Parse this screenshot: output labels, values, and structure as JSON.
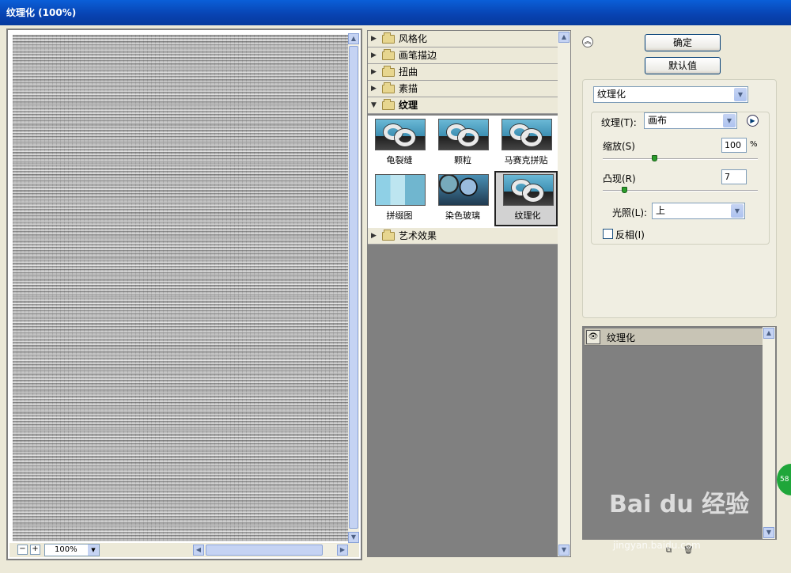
{
  "window": {
    "title": "纹理化 (100%)"
  },
  "preview": {
    "zoom_minus": "−",
    "zoom_plus": "+",
    "zoom_value": "100%"
  },
  "gallery": {
    "categories": [
      {
        "label": "风格化",
        "open": false
      },
      {
        "label": "画笔描边",
        "open": false
      },
      {
        "label": "扭曲",
        "open": false
      },
      {
        "label": "素描",
        "open": false
      },
      {
        "label": "纹理",
        "open": true
      },
      {
        "label": "艺术效果",
        "open": false
      }
    ],
    "filters": [
      {
        "label": "龟裂缝",
        "selected": false
      },
      {
        "label": "颗粒",
        "selected": false
      },
      {
        "label": "马赛克拼贴",
        "selected": false
      },
      {
        "label": "拼缀图",
        "selected": false
      },
      {
        "label": "染色玻璃",
        "selected": false
      },
      {
        "label": "纹理化",
        "selected": true
      }
    ]
  },
  "buttons": {
    "ok": "确定",
    "default": "默认值"
  },
  "settings": {
    "filter_select": "纹理化",
    "texture_label": "纹理(T):",
    "texture_value": "画布",
    "scaling_label": "缩放(S)",
    "scaling_value": "100",
    "scaling_unit": "%",
    "scaling_percent": 100,
    "relief_label": "凸现(R)",
    "relief_value": "7",
    "relief_level": 7,
    "light_label": "光照(L):",
    "light_value": "上",
    "invert_label": "反相(I)",
    "invert_checked": false
  },
  "layers": {
    "items": [
      {
        "label": "纹理化",
        "visible": true
      }
    ]
  },
  "watermark": {
    "brand": "Bai du 经验",
    "url": "jingyan.baidu.com",
    "badge": "58"
  }
}
